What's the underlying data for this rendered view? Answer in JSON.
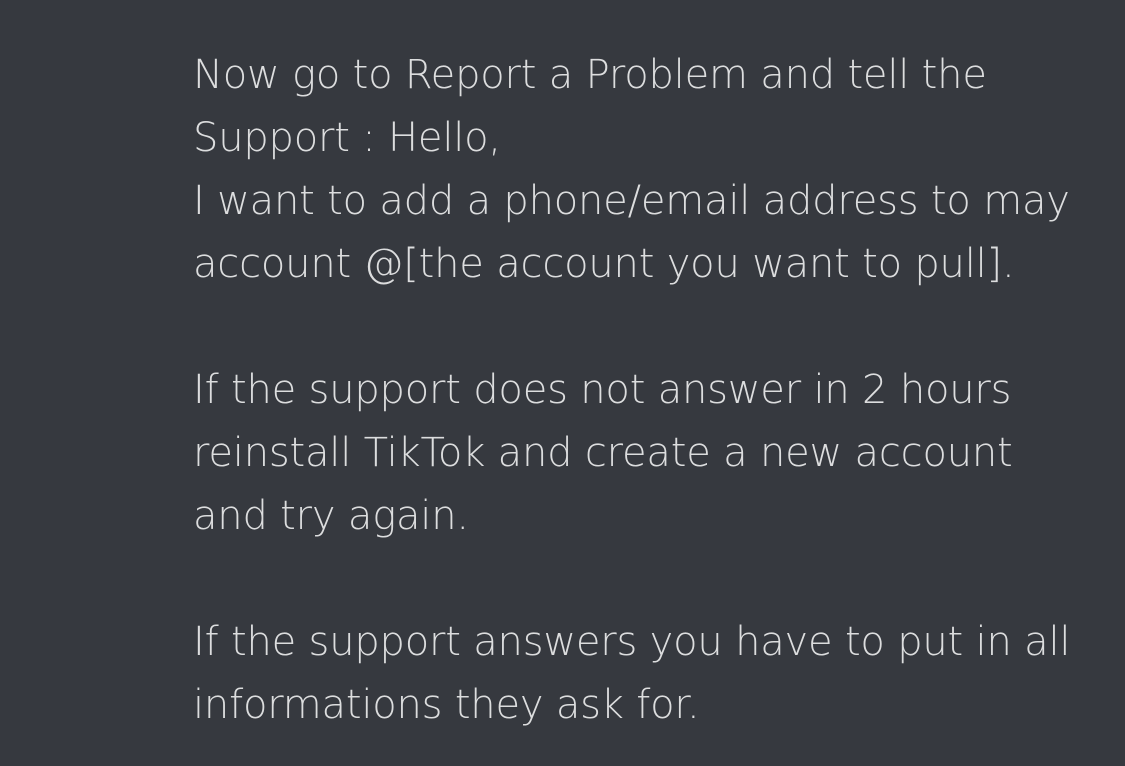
{
  "message": {
    "paragraph_1": {
      "line_1": "Now go to Report a Problem and tell the",
      "line_2": "Support : Hello,",
      "line_3": "I want to add a phone/email address to may",
      "line_4": "account @[the account you want to pull]."
    },
    "paragraph_2": {
      "line_1": "If the support does not answer in 2 hours",
      "line_2": "reinstall TikTok and create a new account",
      "line_3": "and try again."
    },
    "paragraph_3": {
      "line_1": "If the support answers you have to put in all",
      "line_2": "informations they ask for."
    }
  },
  "colors": {
    "background": "#36393f",
    "text": "#dcddde"
  }
}
